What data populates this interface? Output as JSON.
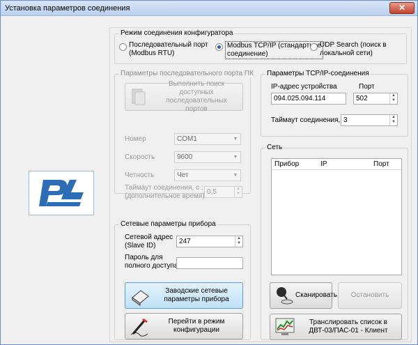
{
  "window": {
    "title": "Установка параметров соединения",
    "close_label": "✕"
  },
  "mode": {
    "legend": "Режим соединения конфигуратора",
    "options": [
      {
        "label": "Последовательный порт (Modbus RTU)",
        "line1": "Последовательный порт",
        "line2": "(Modbus RTU)",
        "checked": false
      },
      {
        "label": "Modbus TCP/IP (стандартное соединение)",
        "line1": "Modbus TCP/IP (стандартное",
        "line2": "соединение)",
        "checked": true
      },
      {
        "label": "UDP Search (поиск в локальной сети)",
        "line1": "UDP Search (поиск в",
        "line2": "локальной сети)",
        "checked": false
      }
    ]
  },
  "serial": {
    "legend": "Параметры последовательного порта ПК",
    "search_button_line1": "Выполнить поиск доступных",
    "search_button_line2": "последовательных портов",
    "number_label": "Номер",
    "number_value": "COM1",
    "speed_label": "Скорость",
    "speed_value": "9600",
    "parity_label": "Четность",
    "parity_value": "Чет",
    "timeout_label_line1": "Таймаут соединения, с :",
    "timeout_label_line2": "(дополнительное время)",
    "timeout_value": "0,5"
  },
  "device": {
    "legend": "Сетевые параметры прибора",
    "address_label_line1": "Сетевой адрес",
    "address_label_line2": "(Slave ID)",
    "address_value": "247",
    "password_label_line1": "Пароль для",
    "password_label_line2": "полного доступа",
    "password_value": "",
    "factory_button_line1": "Заводские сетевые",
    "factory_button_line2": "параметры прибора",
    "config_button_line1": "Перейти в режим",
    "config_button_line2": "конфигурации"
  },
  "tcp": {
    "legend": "Параметры TCP/IP-соединения",
    "ip_label": "IP-адрес устройства",
    "ip_value": "094.025.094.114",
    "port_label": "Порт",
    "port_value": "502",
    "timeout_label": "Таймаут соединения, с:",
    "timeout_value": "3"
  },
  "network": {
    "legend": "Сеть",
    "columns": [
      "Прибор",
      "IP",
      "Порт"
    ],
    "rows": [],
    "scan_label": "Сканировать",
    "stop_label": "Остановить",
    "broadcast_line1": "Транслировать список в",
    "broadcast_line2": "ДВТ-03/ПАС-01 - Клиент"
  },
  "colors": {
    "accent": "#2a5ca8",
    "logo_blue": "#2d6db5",
    "button_blue": "#bfe1f7"
  }
}
